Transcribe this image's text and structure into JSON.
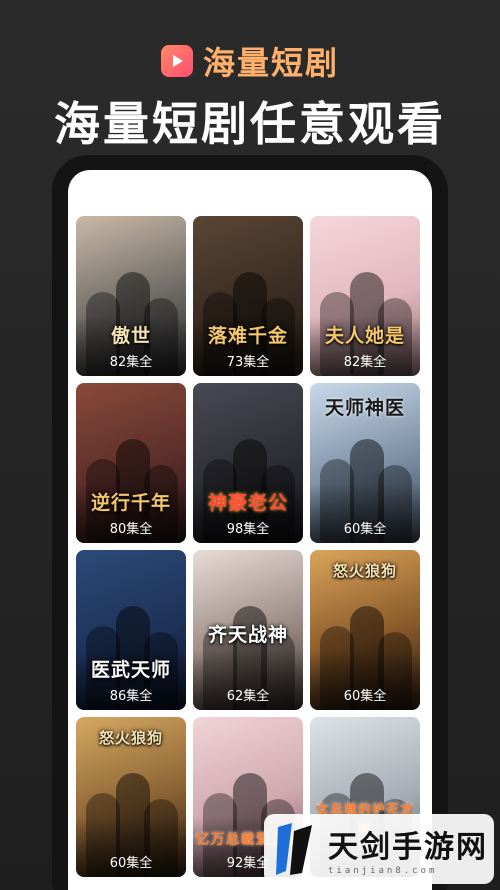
{
  "brand": {
    "name": "海量短剧",
    "icon": "play-icon",
    "accent": "#ffb06a"
  },
  "headline": "海量短剧任意观看",
  "dramas": [
    {
      "title": "傲世",
      "episodes": "82集全"
    },
    {
      "title": "落难千金",
      "episodes": "73集全"
    },
    {
      "title": "夫人她是",
      "episodes": "82集全"
    },
    {
      "title": "逆行千年",
      "episodes": "80集全"
    },
    {
      "title": "神豪老公",
      "episodes": "98集全"
    },
    {
      "title": "天师神医",
      "episodes": "60集全"
    },
    {
      "title": "医武天师",
      "episodes": "86集全"
    },
    {
      "title": "齐天战神",
      "episodes": "62集全"
    },
    {
      "title": "怒火狼狗",
      "episodes": "60集全"
    },
    {
      "title": "怒火狼狗",
      "episodes": "60集全"
    },
    {
      "title": "亿万总裁爱上我",
      "episodes": "92集全"
    },
    {
      "title": "女总裁的护花龙尊",
      "episodes": ""
    }
  ],
  "watermark": {
    "name": "天剑手游网",
    "url": "tianjian8.com"
  }
}
